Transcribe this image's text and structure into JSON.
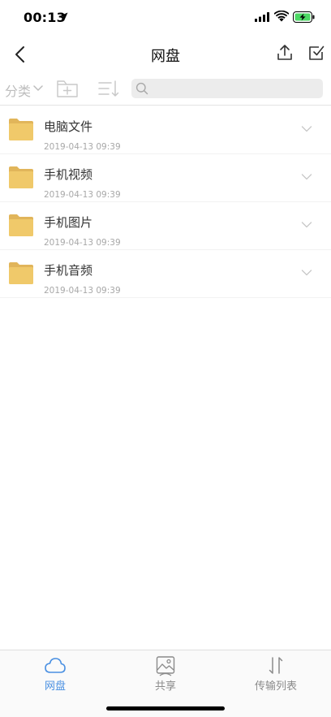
{
  "status": {
    "time": "00:13"
  },
  "nav": {
    "title": "网盘"
  },
  "toolbar": {
    "category_label": "分类",
    "search_placeholder": ""
  },
  "files": [
    {
      "name": "电脑文件",
      "date": "2019-04-13 09:39",
      "icon": "folder-icon"
    },
    {
      "name": "手机视频",
      "date": "2019-04-13 09:39",
      "icon": "folder-icon"
    },
    {
      "name": "手机图片",
      "date": "2019-04-13 09:39",
      "icon": "folder-icon"
    },
    {
      "name": "手机音频",
      "date": "2019-04-13 09:39",
      "icon": "folder-icon"
    }
  ],
  "tabs": [
    {
      "label": "网盘",
      "icon": "cloud-icon",
      "active": true
    },
    {
      "label": "共享",
      "icon": "share-image-icon",
      "active": false
    },
    {
      "label": "传输列表",
      "icon": "transfer-icon",
      "active": false
    }
  ],
  "colors": {
    "accent": "#4a90e2",
    "folder": "#f0c96a",
    "battery": "#4cd964"
  }
}
